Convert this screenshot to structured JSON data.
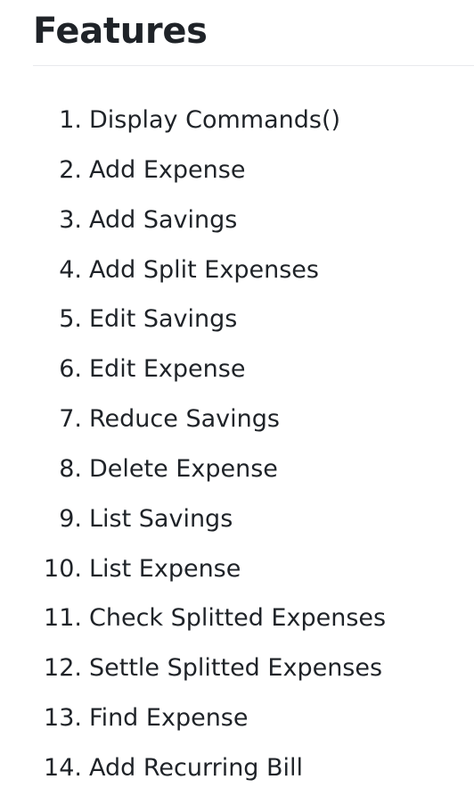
{
  "heading": "Features",
  "features": [
    {
      "num": "1.",
      "label": "Display Commands()"
    },
    {
      "num": "2.",
      "label": "Add Expense"
    },
    {
      "num": "3.",
      "label": "Add Savings"
    },
    {
      "num": "4.",
      "label": "Add Split Expenses"
    },
    {
      "num": "5.",
      "label": "Edit Savings"
    },
    {
      "num": "6.",
      "label": "Edit Expense"
    },
    {
      "num": "7.",
      "label": "Reduce Savings"
    },
    {
      "num": "8.",
      "label": "Delete Expense"
    },
    {
      "num": "9.",
      "label": "List Savings"
    },
    {
      "num": "10.",
      "label": "List Expense"
    },
    {
      "num": "11.",
      "label": "Check Splitted Expenses"
    },
    {
      "num": "12.",
      "label": "Settle Splitted Expenses"
    },
    {
      "num": "13.",
      "label": "Find Expense"
    },
    {
      "num": "14.",
      "label": "Add Recurring Bill"
    }
  ]
}
